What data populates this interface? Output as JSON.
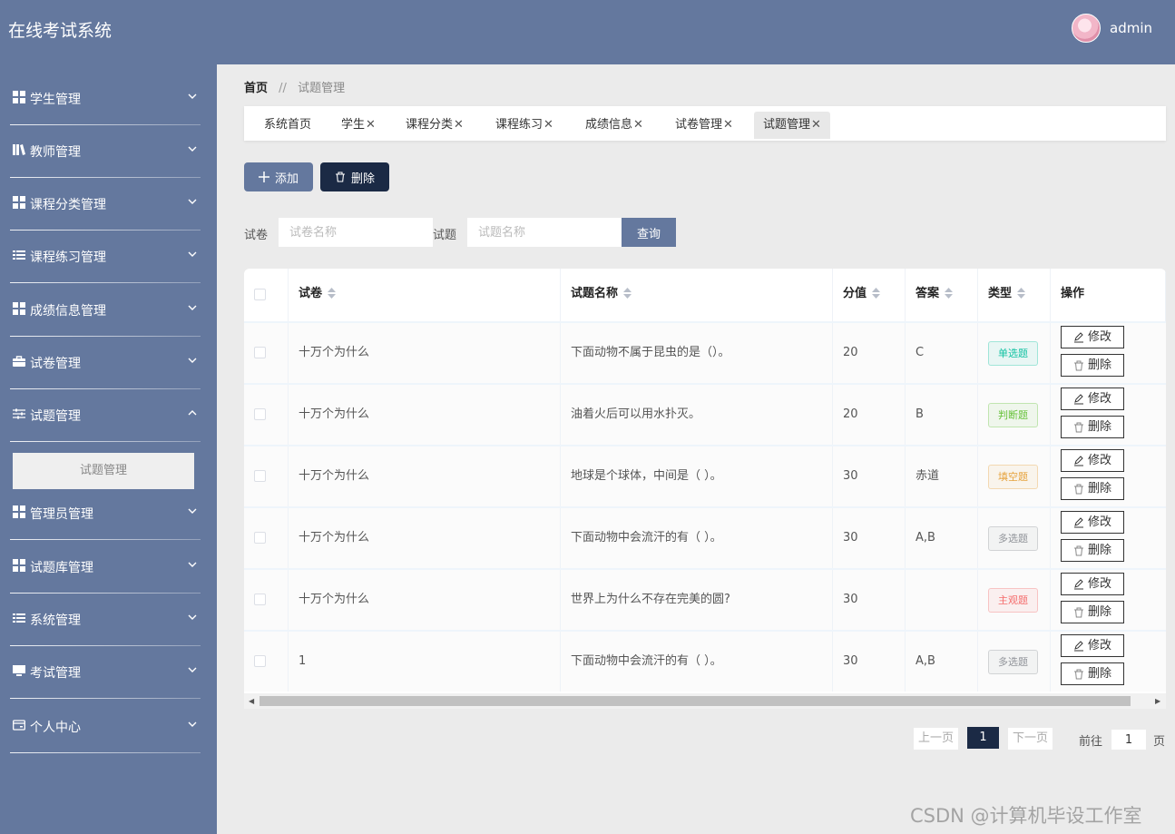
{
  "header": {
    "title": "在线考试系统",
    "user": "admin"
  },
  "sidebar": {
    "items": [
      {
        "label": "学生管理",
        "icon": "grid-icon",
        "expanded": false
      },
      {
        "label": "教师管理",
        "icon": "books-icon",
        "expanded": false
      },
      {
        "label": "课程分类管理",
        "icon": "grid-icon",
        "expanded": false
      },
      {
        "label": "课程练习管理",
        "icon": "list-icon",
        "expanded": false
      },
      {
        "label": "成绩信息管理",
        "icon": "grid-icon",
        "expanded": false
      },
      {
        "label": "试卷管理",
        "icon": "briefcase-icon",
        "expanded": false
      },
      {
        "label": "试题管理",
        "icon": "sliders-icon",
        "expanded": true
      },
      {
        "label": "管理员管理",
        "icon": "grid-icon",
        "expanded": false
      },
      {
        "label": "试题库管理",
        "icon": "grid-icon",
        "expanded": false
      },
      {
        "label": "系统管理",
        "icon": "list-icon",
        "expanded": false
      },
      {
        "label": "考试管理",
        "icon": "monitor-icon",
        "expanded": false
      },
      {
        "label": "个人中心",
        "icon": "card-icon",
        "expanded": false
      }
    ],
    "submenu": {
      "label": "试题管理"
    }
  },
  "breadcrumb": {
    "home": "首页",
    "separator": "//",
    "current": "试题管理"
  },
  "tabs": [
    {
      "label": "系统首页",
      "closable": false,
      "active": false
    },
    {
      "label": "学生",
      "closable": true,
      "active": false
    },
    {
      "label": "课程分类",
      "closable": true,
      "active": false
    },
    {
      "label": "课程练习",
      "closable": true,
      "active": false
    },
    {
      "label": "成绩信息",
      "closable": true,
      "active": false
    },
    {
      "label": "试卷管理",
      "closable": true,
      "active": false
    },
    {
      "label": "试题管理",
      "closable": true,
      "active": true
    }
  ],
  "toolbar": {
    "add": "添加",
    "delete": "删除"
  },
  "search": {
    "paper_label": "试卷",
    "paper_placeholder": "试卷名称",
    "question_label": "试题",
    "question_placeholder": "试题名称",
    "query": "查询"
  },
  "table": {
    "columns": [
      "试卷",
      "试题名称",
      "分值",
      "答案",
      "类型",
      "操作"
    ],
    "rows": [
      {
        "paper": "十万个为什么",
        "question": "下面动物不属于昆虫的是（）。",
        "score": "20",
        "answer": "C",
        "type": "单选题",
        "type_color": "#13c2a3"
      },
      {
        "paper": "十万个为什么",
        "question": "油着火后可以用水扑灭。",
        "score": "20",
        "answer": "B",
        "type": "判断题",
        "type_color": "#67c23a"
      },
      {
        "paper": "十万个为什么",
        "question": "地球是个球体，中间是（ ）。",
        "score": "30",
        "answer": "赤道",
        "type": "填空题",
        "type_color": "#e6a23c"
      },
      {
        "paper": "十万个为什么",
        "question": "下面动物中会流汗的有（ ）。",
        "score": "30",
        "answer": "A,B",
        "type": "多选题",
        "type_color": "#909399"
      },
      {
        "paper": "十万个为什么",
        "question": "世界上为什么不存在完美的圆?",
        "score": "30",
        "answer": "",
        "type": "主观题",
        "type_color": "#f56c6c"
      },
      {
        "paper": "1",
        "question": "下面动物中会流汗的有（ ）。",
        "score": "30",
        "answer": "A,B",
        "type": "多选题",
        "type_color": "#909399"
      }
    ],
    "edit": "修改",
    "delete": "删除"
  },
  "pagination": {
    "prev": "上一页",
    "current": "1",
    "next": "下一页",
    "goto": "前往",
    "goto_value": "1",
    "page_unit": "页"
  },
  "watermark": "CSDN @计算机毕设工作室",
  "colors": {
    "primary": "#64789e",
    "dark": "#1b2a45"
  }
}
